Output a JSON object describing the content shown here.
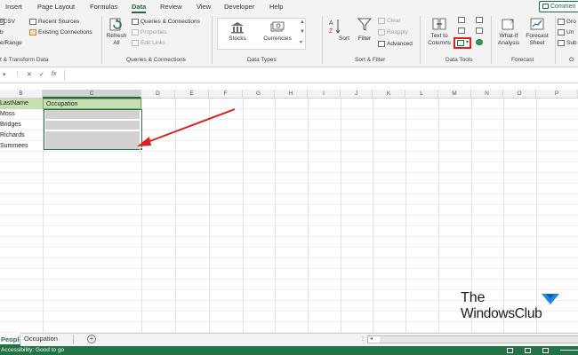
{
  "menu": {
    "tabs": [
      "Insert",
      "Page Layout",
      "Formulas",
      "Data",
      "Review",
      "View",
      "Developer",
      "Help"
    ],
    "comments": "Commen"
  },
  "ribbon": {
    "get_data": {
      "csv": "t/CSV",
      "web": "b",
      "range": "e/Range",
      "recent": "Recent Sources",
      "existing": "Existing Connections",
      "group": "t & Transform Data"
    },
    "queries": {
      "refresh": "Refresh",
      "refresh_all": "All",
      "qc": "Queries & Connections",
      "properties": "Properties",
      "edit_links": "Edit Links",
      "group": "Queries & Connections"
    },
    "data_types": {
      "stocks": "Stocks",
      "currencies": "Currencies",
      "group": "Data Types"
    },
    "sort_filter": {
      "sort": "Sort",
      "filter": "Filter",
      "clear": "Clear",
      "reapply": "Reapply",
      "advanced": "Advanced",
      "group": "Sort & Filter"
    },
    "data_tools": {
      "text_to": "Text to",
      "columns": "Columns",
      "group": "Data Tools"
    },
    "forecast": {
      "what_if": "What-If",
      "analysis": "Analysis",
      "forecast": "Forecast",
      "sheet": "Sheet",
      "group": "Forecast"
    },
    "outline": {
      "grp": "Gro",
      "ungrp": "Un",
      "sub": "Sub",
      "group": "O"
    }
  },
  "formula_bar": {
    "cancel": "✕",
    "enter": "✓",
    "fx": "fx",
    "value": ""
  },
  "columns": [
    "B",
    "C",
    "D",
    "E",
    "F",
    "G",
    "H",
    "I",
    "J",
    "K",
    "L",
    "M",
    "N",
    "O",
    "P"
  ],
  "cells": {
    "b_header": "LastName",
    "c_header": "Occupation",
    "names": [
      "Moss",
      "Bridges",
      "Richards",
      "Summees"
    ]
  },
  "watermark": {
    "line1": "The",
    "line2": "WindowsClub"
  },
  "sheets": {
    "active": "People",
    "other": "Occupation",
    "add": "+"
  },
  "status": {
    "text": "Accessibility: Good to go"
  },
  "colors": {
    "accent": "#217346",
    "header_fill": "#c6e0b4",
    "shaded": "#d1d1d1",
    "arrow": "#e02020"
  }
}
